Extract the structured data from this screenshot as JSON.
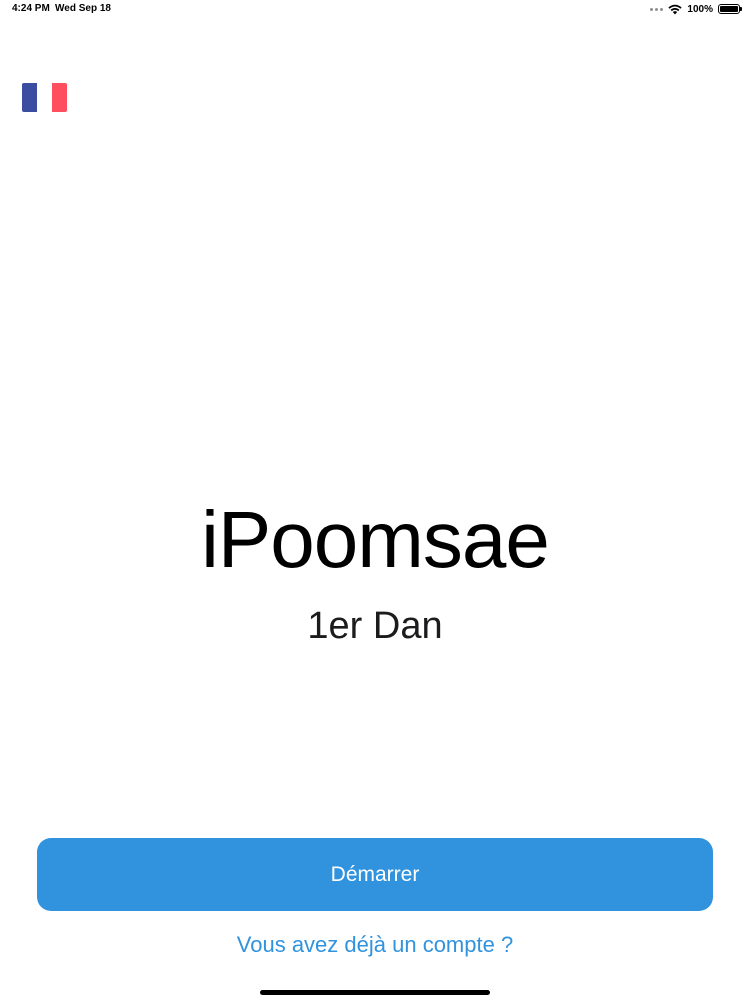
{
  "status_bar": {
    "time": "4:24 PM",
    "date": "Wed Sep 18",
    "battery": "100%",
    "icons": [
      "multitask-dots-icon",
      "wifi-icon",
      "battery-icon"
    ]
  },
  "language": {
    "icon": "france-flag-icon",
    "colors": [
      "#3b4da1",
      "#ffffff",
      "#ff4f5e"
    ]
  },
  "main": {
    "title": "iPoomsae",
    "subtitle": "1er Dan"
  },
  "actions": {
    "start_label": "Démarrer",
    "account_link": "Vous avez déjà un compte ?"
  },
  "colors": {
    "accent": "#3193dd",
    "link": "#3193dd"
  }
}
